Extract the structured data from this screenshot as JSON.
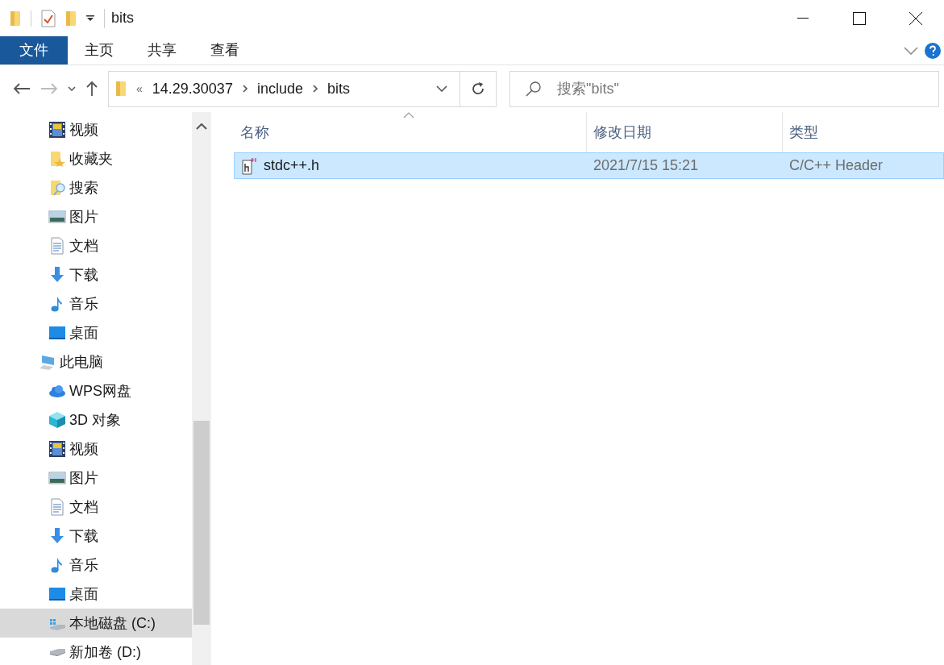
{
  "window": {
    "title": "bits"
  },
  "ribbon_tabs": [
    {
      "label": "文件",
      "selected": true
    },
    {
      "label": "主页",
      "selected": false
    },
    {
      "label": "共享",
      "selected": false
    },
    {
      "label": "查看",
      "selected": false
    }
  ],
  "address_bar": {
    "overflow": "«",
    "segments": [
      "14.29.30037",
      "include",
      "bits"
    ]
  },
  "search": {
    "placeholder": "搜索\"bits\""
  },
  "sidebar": {
    "groups": [
      {
        "items": [
          {
            "label": "视频",
            "kind": "video",
            "selected": false
          },
          {
            "label": "收藏夹",
            "kind": "favorites",
            "selected": false
          },
          {
            "label": "搜索",
            "kind": "search",
            "selected": false
          },
          {
            "label": "图片",
            "kind": "pictures",
            "selected": false
          },
          {
            "label": "文档",
            "kind": "documents",
            "selected": false
          },
          {
            "label": "下载",
            "kind": "download",
            "selected": false
          },
          {
            "label": "音乐",
            "kind": "music",
            "selected": false
          },
          {
            "label": "桌面",
            "kind": "desktop",
            "selected": false
          }
        ]
      },
      {
        "label": "此电脑",
        "kind": "pc",
        "selected": false,
        "items": [
          {
            "label": "WPS网盘",
            "kind": "cloud",
            "selected": false
          },
          {
            "label": "3D 对象",
            "kind": "cube",
            "selected": false
          },
          {
            "label": "视频",
            "kind": "video",
            "selected": false
          },
          {
            "label": "图片",
            "kind": "pictures",
            "selected": false
          },
          {
            "label": "文档",
            "kind": "documents",
            "selected": false
          },
          {
            "label": "下载",
            "kind": "download",
            "selected": false
          },
          {
            "label": "音乐",
            "kind": "music",
            "selected": false
          },
          {
            "label": "桌面",
            "kind": "desktop",
            "selected": false
          },
          {
            "label": "本地磁盘 (C:)",
            "kind": "system-drive",
            "selected": true
          },
          {
            "label": "新加卷 (D:)",
            "kind": "drive",
            "selected": false
          }
        ]
      }
    ]
  },
  "file_list": {
    "columns": [
      "名称",
      "修改日期",
      "类型"
    ],
    "rows": [
      {
        "name": "stdc++.h",
        "modified": "2021/7/15 15:21",
        "type": "C/C++ Header",
        "selected": true
      }
    ]
  }
}
